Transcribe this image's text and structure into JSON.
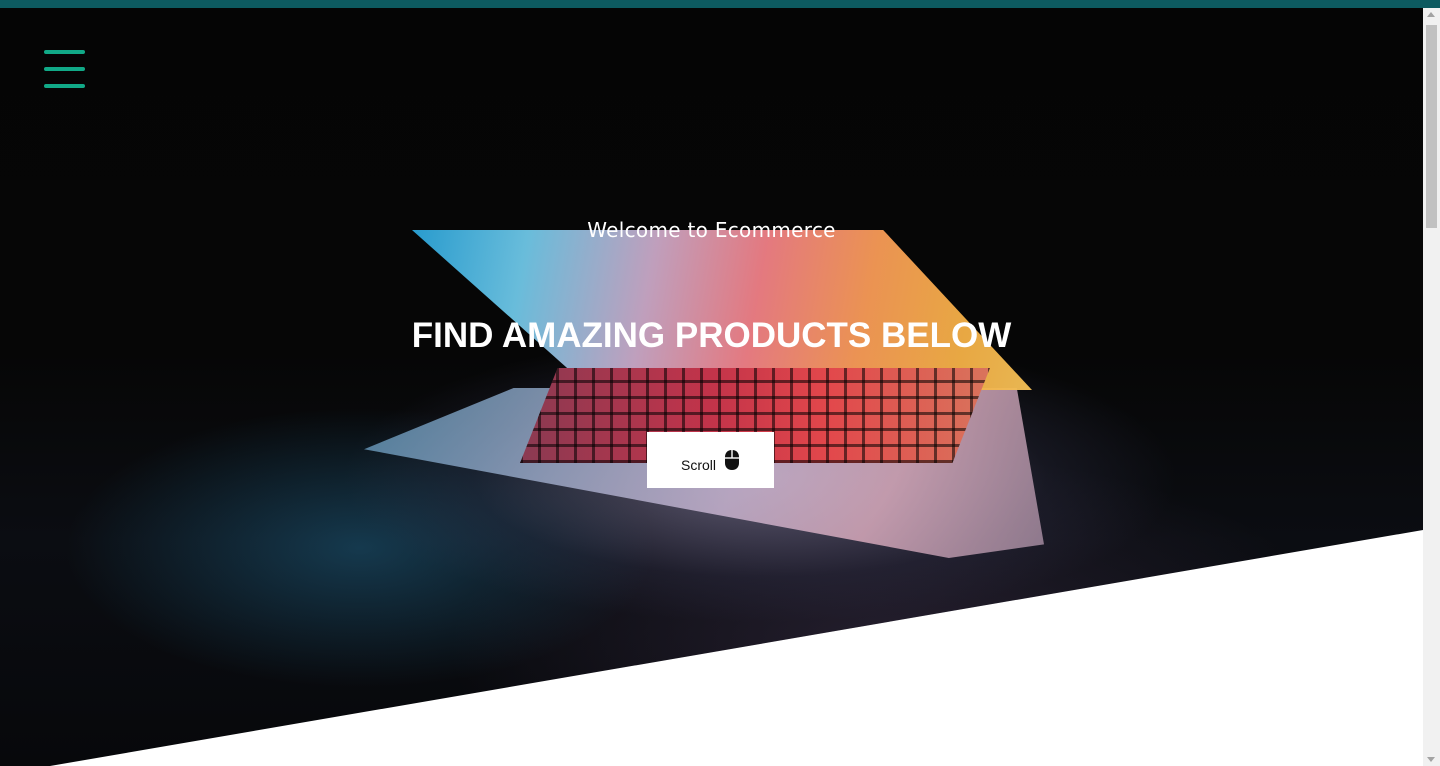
{
  "hero": {
    "welcome_text": "Welcome to Ecommerce",
    "headline": "FIND AMAZING PRODUCTS BELOW",
    "scroll_label": "Scroll",
    "scroll_icon": "mouse-icon",
    "background_image": "open laptop glowing in the dark"
  },
  "menu": {
    "icon": "hamburger-menu-icon"
  },
  "colors": {
    "top_bar": "#0d5a60",
    "menu_icon": "#11a987",
    "hero_background": "#050505",
    "text": "#ffffff",
    "scroll_button_background": "#ffffff"
  }
}
